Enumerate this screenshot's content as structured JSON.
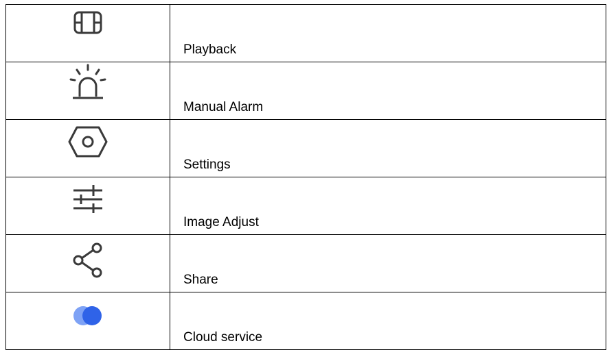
{
  "rows": [
    {
      "icon": "film-icon",
      "label": "Playback"
    },
    {
      "icon": "alarm-light-icon",
      "label": "Manual Alarm"
    },
    {
      "icon": "hex-nut-settings-icon",
      "label": "Settings"
    },
    {
      "icon": "sliders-adjust-icon",
      "label": "Image Adjust"
    },
    {
      "icon": "share-icon",
      "label": "Share"
    },
    {
      "icon": "cloud-icon",
      "label": "Cloud service"
    }
  ],
  "colors": {
    "icon_gray": "#3a3a3a",
    "cloud_light": "#7ea2f5",
    "cloud_dark": "#2f63e8",
    "border": "#000000"
  }
}
